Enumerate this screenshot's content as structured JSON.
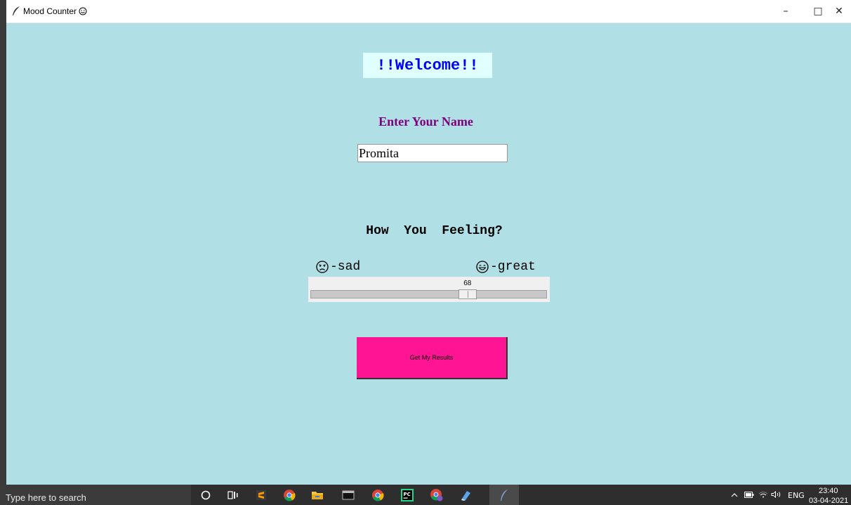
{
  "window": {
    "title": "Mood Counter",
    "minimize": "–",
    "maximize": "□",
    "close": "✕"
  },
  "app": {
    "welcome": "!!Welcome!!",
    "name_label": "Enter Your Name",
    "name_value": "Promita",
    "feeling_question": "How  You  Feeling?",
    "sad_label": "-sad",
    "great_label": "-great",
    "slider": {
      "value": "68",
      "min": 0,
      "max": 100
    },
    "results_button": "Get My Results"
  },
  "taskbar": {
    "search_placeholder": "Type here to search",
    "tray_lang": "ENG",
    "time": "23:40",
    "date": "03-04-2021"
  },
  "colors": {
    "background": "#b0dfe5",
    "welcome_text": "#0000ff",
    "welcome_bg": "#e0ffff",
    "name_label": "#800080",
    "button": "#ff1493"
  }
}
